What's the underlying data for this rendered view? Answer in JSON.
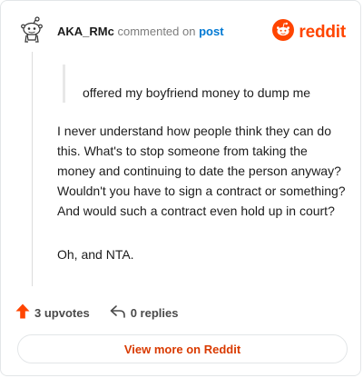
{
  "header": {
    "username": "AKA_RMc",
    "commented_text": "commented on",
    "post_link": "post",
    "brand": "reddit"
  },
  "quote": {
    "text": "offered my boyfriend money to dump me"
  },
  "comment": {
    "paragraphs": [
      "I never understand how people think they can do this. What's to stop someone from taking the money and continuing to date the person anyway? Wouldn't you have to sign a contract or something? And would such a contract even hold up in court?",
      "Oh, and NTA."
    ]
  },
  "actions": {
    "upvotes": "3 upvotes",
    "replies": "0 replies"
  },
  "footer": {
    "view_more": "View more on Reddit"
  },
  "colors": {
    "brand": "#ff4500",
    "link": "#0079d3",
    "view_more": "#d93a00"
  },
  "icons": [
    "snoo-avatar-icon",
    "reddit-logo-icon",
    "upvote-arrow-icon",
    "reply-arrow-icon"
  ]
}
